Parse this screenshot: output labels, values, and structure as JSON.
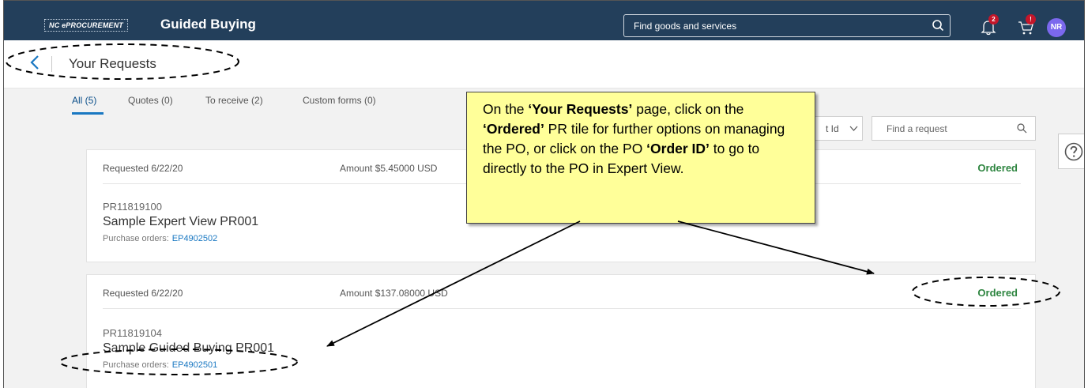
{
  "header": {
    "brand": "NC ePROCUREMENT",
    "app_title": "Guided Buying",
    "search_placeholder": "Find goods and services",
    "notifications_count": "2",
    "cart_count": "!",
    "avatar_initials": "NR"
  },
  "subheader": {
    "title": "Your Requests"
  },
  "tabs": [
    {
      "label": "All (5)",
      "active": true
    },
    {
      "label": "Quotes (0)"
    },
    {
      "label": "To receive (2)"
    },
    {
      "label": "Custom forms (0)"
    }
  ],
  "toolbar": {
    "sort_label": "t Id",
    "find_placeholder": "Find a request"
  },
  "requests": [
    {
      "requested": "Requested 6/22/20",
      "amount": "Amount  $5.45000 USD",
      "status": "Ordered",
      "pr_id": "PR11819100",
      "name": "Sample Expert View PR001",
      "po_label": "Purchase orders:",
      "po_id": "EP4902502"
    },
    {
      "requested": "Requested 6/22/20",
      "amount": "Amount  $137.08000 USD",
      "status": "Ordered",
      "pr_id": "PR11819104",
      "name": "Sample Guided Buying PR001",
      "po_label": "Purchase orders:",
      "po_id": "EP4902501"
    }
  ],
  "callout": {
    "t1": "On the ",
    "b1": "‘Your Requests’",
    "t2": " page, click on the ",
    "b2": "‘Ordered’",
    "t3": " PR tile for further options on managing the PO, or click on the PO ",
    "b3": "‘Order ID’",
    "t4": " to go to directly to the PO in Expert View."
  },
  "colors": {
    "topbar": "#233f5b",
    "status_ordered": "#2e8540",
    "link": "#1a78c2",
    "callout_bg": "#ffff99",
    "avatar": "#7b68ee"
  }
}
